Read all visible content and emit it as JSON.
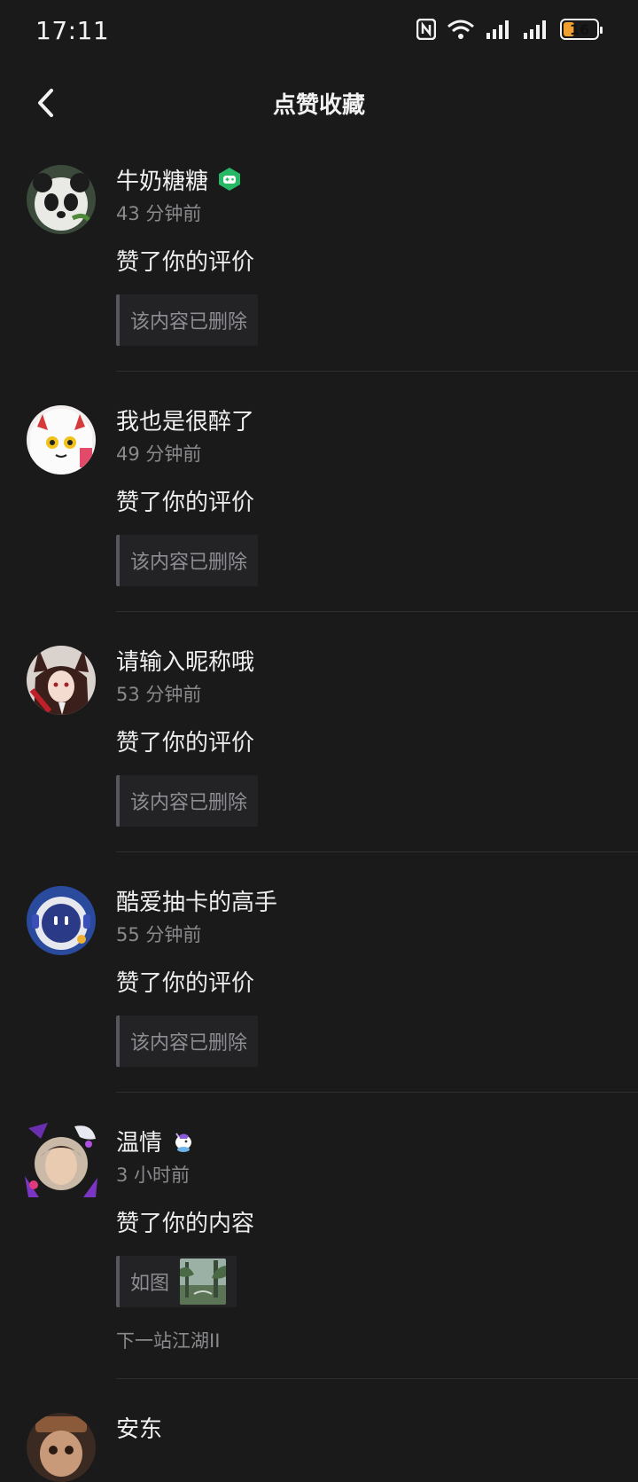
{
  "status_bar": {
    "time": "17:11",
    "battery": "16"
  },
  "header": {
    "title": "点赞收藏"
  },
  "feed": [
    {
      "name": "牛奶糖糖",
      "time": "43 分钟前",
      "action": "赞了你的评价",
      "quote": "该内容已删除"
    },
    {
      "name": "我也是很醉了",
      "time": "49 分钟前",
      "action": "赞了你的评价",
      "quote": "该内容已删除"
    },
    {
      "name": "请输入昵称哦",
      "time": "53 分钟前",
      "action": "赞了你的评价",
      "quote": "该内容已删除"
    },
    {
      "name": "酷爱抽卡的高手",
      "time": "55 分钟前",
      "action": "赞了你的评价",
      "quote": "该内容已删除"
    },
    {
      "name": "温情",
      "time": "3 小时前",
      "action": "赞了你的内容",
      "quote": "如图",
      "source": "下一站江湖II"
    },
    {
      "name": "安东"
    }
  ]
}
